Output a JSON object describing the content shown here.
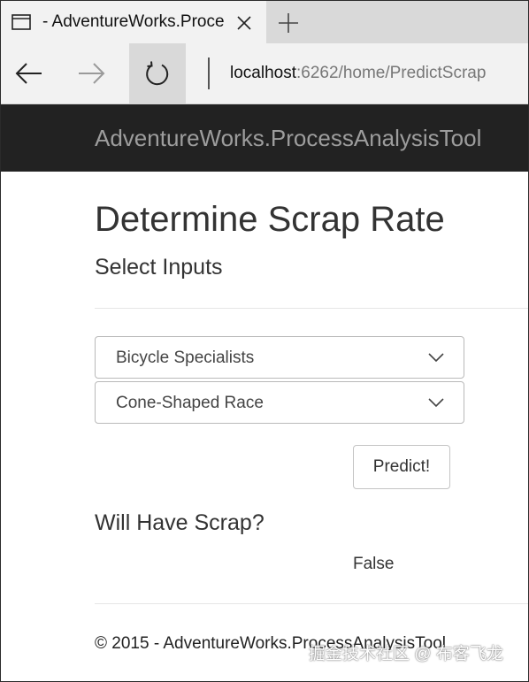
{
  "browser": {
    "tab": {
      "title": "- AdventureWorks.ProcessAnalysisTool",
      "page_icon": "page-icon",
      "close_icon": "close-icon"
    },
    "new_tab_icon": "plus-icon",
    "nav": {
      "back_icon": "arrow-left-icon",
      "forward_icon": "arrow-right-icon",
      "refresh_icon": "refresh-icon"
    },
    "address": {
      "host": "localhost",
      "path": ":6262/home/PredictScrap"
    }
  },
  "site": {
    "brand": "AdventureWorks.ProcessAnalysisTool"
  },
  "main": {
    "title": "Determine Scrap Rate",
    "subtitle": "Select Inputs",
    "selects": [
      {
        "value": "Bicycle Specialists",
        "icon": "chevron-down-icon"
      },
      {
        "value": "Cone-Shaped Race",
        "icon": "chevron-down-icon"
      }
    ],
    "predict_label": "Predict!",
    "result_heading": "Will Have Scrap?",
    "result_value": "False"
  },
  "footer": {
    "text": "© 2015 - AdventureWorks.ProcessAnalysisTool"
  },
  "watermark": {
    "text": "掘金技术社区 @ 布客飞龙"
  },
  "colors": {
    "header_bg": "#222222",
    "brand_text": "#9d9d9d",
    "tab_bg": "#f2f2f2",
    "tabstrip_bg": "#d9d9d9"
  }
}
